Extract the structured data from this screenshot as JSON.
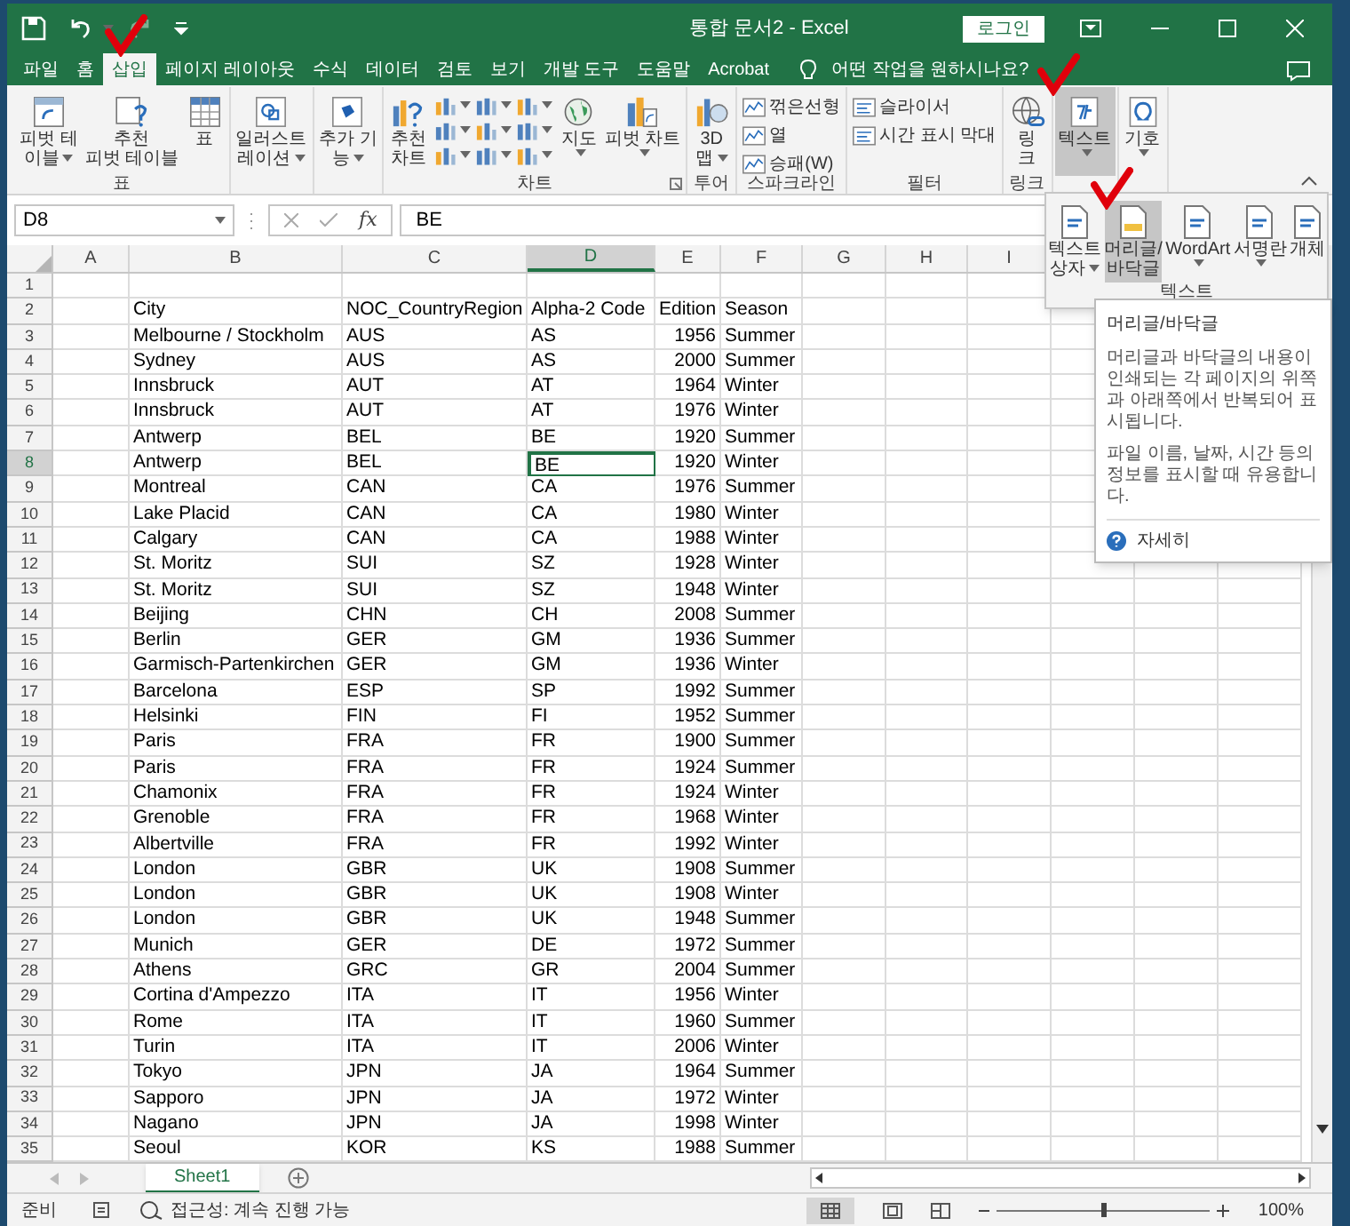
{
  "title_bar": {
    "title": "통합 문서2 - Excel",
    "login": "로그인"
  },
  "tabs": [
    {
      "label": "파일",
      "selected": false
    },
    {
      "label": "홈",
      "selected": false
    },
    {
      "label": "삽입",
      "selected": true
    },
    {
      "label": "페이지 레이아웃",
      "selected": false
    },
    {
      "label": "수식",
      "selected": false
    },
    {
      "label": "데이터",
      "selected": false
    },
    {
      "label": "검토",
      "selected": false
    },
    {
      "label": "보기",
      "selected": false
    },
    {
      "label": "개발 도구",
      "selected": false
    },
    {
      "label": "도움말",
      "selected": false
    },
    {
      "label": "Acrobat",
      "selected": false
    }
  ],
  "tell_me": "어떤 작업을 원하시나요?",
  "ribbon": {
    "groups": [
      {
        "label": "표",
        "launcher": false,
        "items": [
          {
            "kind": "large",
            "lines": [
              "피벗 테",
              "이블"
            ],
            "dropdown": true,
            "expanded": false
          },
          {
            "kind": "large",
            "lines": [
              "추천",
              "피벗 테이블"
            ],
            "dropdown": false,
            "expanded": false
          },
          {
            "kind": "large",
            "lines": [
              "표"
            ],
            "dropdown": false,
            "expanded": false
          }
        ]
      },
      {
        "launcher": false,
        "items": [
          {
            "kind": "large",
            "lines": [
              "일러스트",
              "레이션"
            ],
            "dropdown": true,
            "expanded": false
          }
        ]
      },
      {
        "launcher": false,
        "items": [
          {
            "kind": "large",
            "lines": [
              "추가 기",
              "능"
            ],
            "dropdown": true,
            "expanded": false
          }
        ]
      },
      {
        "label": "차트",
        "launcher": true,
        "items": [
          {
            "kind": "large",
            "lines": [
              "추천",
              "차트"
            ],
            "dropdown": false,
            "expanded": false
          },
          {
            "kind": "chart_grid"
          },
          {
            "kind": "large",
            "lines": [
              "지도"
            ],
            "dropdown": true,
            "expanded": false
          },
          {
            "kind": "large",
            "lines": [
              "피벗 차트"
            ],
            "dropdown": true,
            "expanded": false
          }
        ]
      },
      {
        "label": "투어",
        "launcher": false,
        "items": [
          {
            "kind": "large",
            "lines": [
              "3D",
              "맵"
            ],
            "dropdown": true,
            "expanded": false
          }
        ]
      },
      {
        "label": "스파크라인",
        "launcher": false,
        "items": [
          {
            "kind": "small",
            "label": "꺾은선형"
          },
          {
            "kind": "small",
            "label": "열"
          },
          {
            "kind": "small",
            "label": "승패(W)"
          }
        ]
      },
      {
        "label": "필터",
        "launcher": false,
        "items": [
          {
            "kind": "small",
            "label": "슬라이서"
          },
          {
            "kind": "small",
            "label": "시간 표시 막대"
          }
        ]
      },
      {
        "label": "링크",
        "launcher": false,
        "items": [
          {
            "kind": "large",
            "lines": [
              "링",
              "크"
            ],
            "dropdown": false,
            "expanded": false
          }
        ]
      },
      {
        "launcher": false,
        "items": [
          {
            "kind": "large",
            "lines": [
              "텍스트"
            ],
            "dropdown": true,
            "expanded": true
          }
        ]
      },
      {
        "launcher": false,
        "items": [
          {
            "kind": "large",
            "lines": [
              "기호"
            ],
            "dropdown": true,
            "expanded": false
          }
        ]
      }
    ]
  },
  "text_panel": {
    "label": "텍스트",
    "items": [
      {
        "lines": [
          "텍스트",
          "상자"
        ],
        "dropdown": true,
        "selected": false
      },
      {
        "lines": [
          "머리글/",
          "바닥글"
        ],
        "dropdown": false,
        "selected": true
      },
      {
        "lines": [
          "WordArt"
        ],
        "dropdown": true,
        "selected": false
      },
      {
        "lines": [
          "서명란"
        ],
        "dropdown": true,
        "selected": false
      },
      {
        "lines": [
          "개체"
        ],
        "dropdown": false,
        "selected": false
      }
    ]
  },
  "tooltip": {
    "title": "머리글/바닥글",
    "paragraphs": [
      "머리글과 바닥글의 내용이 인쇄되는 각 페이지의 위쪽과 아래쪽에서 반복되어 표시됩니다.",
      "파일 이름, 날짜, 시간 등의 정보를 표시할 때 유용합니다."
    ],
    "link": "자세히"
  },
  "formula_bar": {
    "name_box": "D8",
    "function_label": "fx",
    "value": "BE"
  },
  "columns": [
    {
      "label": "A",
      "selected": false,
      "kind": "text"
    },
    {
      "label": "B",
      "selected": false,
      "kind": "text"
    },
    {
      "label": "C",
      "selected": false,
      "kind": "text"
    },
    {
      "label": "D",
      "selected": true,
      "kind": "text"
    },
    {
      "label": "E",
      "selected": false,
      "kind": "number"
    },
    {
      "label": "F",
      "selected": false,
      "kind": "text"
    },
    {
      "label": "G",
      "selected": false,
      "kind": "text"
    },
    {
      "label": "H",
      "selected": false,
      "kind": "text"
    },
    {
      "label": "I",
      "selected": false,
      "kind": "text"
    }
  ],
  "rows": [
    {
      "number": "1",
      "selected": false,
      "cells": {}
    },
    {
      "number": "2",
      "selected": false,
      "cells": {
        "B": "City",
        "C": "NOC_CountryRegion",
        "D": "Alpha-2 Code",
        "E": "Edition",
        "F": "Season"
      }
    },
    {
      "number": "3",
      "selected": false,
      "cells": {
        "B": "Melbourne / Stockholm",
        "C": "AUS",
        "D": "AS",
        "E": "1956",
        "F": "Summer"
      }
    },
    {
      "number": "4",
      "selected": false,
      "cells": {
        "B": "Sydney",
        "C": "AUS",
        "D": "AS",
        "E": "2000",
        "F": "Summer"
      }
    },
    {
      "number": "5",
      "selected": false,
      "cells": {
        "B": "Innsbruck",
        "C": "AUT",
        "D": "AT",
        "E": "1964",
        "F": "Winter"
      }
    },
    {
      "number": "6",
      "selected": false,
      "cells": {
        "B": "Innsbruck",
        "C": "AUT",
        "D": "AT",
        "E": "1976",
        "F": "Winter"
      }
    },
    {
      "number": "7",
      "selected": false,
      "cells": {
        "B": "Antwerp",
        "C": "BEL",
        "D": "BE",
        "E": "1920",
        "F": "Summer"
      }
    },
    {
      "number": "8",
      "selected": true,
      "cells": {
        "B": "Antwerp",
        "C": "BEL",
        "D": "BE",
        "E": "1920",
        "F": "Winter"
      }
    },
    {
      "number": "9",
      "selected": false,
      "cells": {
        "B": "Montreal",
        "C": "CAN",
        "D": "CA",
        "E": "1976",
        "F": "Summer"
      }
    },
    {
      "number": "10",
      "selected": false,
      "cells": {
        "B": "Lake Placid",
        "C": "CAN",
        "D": "CA",
        "E": "1980",
        "F": "Winter"
      }
    },
    {
      "number": "11",
      "selected": false,
      "cells": {
        "B": "Calgary",
        "C": "CAN",
        "D": "CA",
        "E": "1988",
        "F": "Winter"
      }
    },
    {
      "number": "12",
      "selected": false,
      "cells": {
        "B": "St. Moritz",
        "C": "SUI",
        "D": "SZ",
        "E": "1928",
        "F": "Winter"
      }
    },
    {
      "number": "13",
      "selected": false,
      "cells": {
        "B": "St. Moritz",
        "C": "SUI",
        "D": "SZ",
        "E": "1948",
        "F": "Winter"
      }
    },
    {
      "number": "14",
      "selected": false,
      "cells": {
        "B": "Beijing",
        "C": "CHN",
        "D": "CH",
        "E": "2008",
        "F": "Summer"
      }
    },
    {
      "number": "15",
      "selected": false,
      "cells": {
        "B": "Berlin",
        "C": "GER",
        "D": "GM",
        "E": "1936",
        "F": "Summer"
      }
    },
    {
      "number": "16",
      "selected": false,
      "cells": {
        "B": "Garmisch-Partenkirchen",
        "C": "GER",
        "D": "GM",
        "E": "1936",
        "F": "Winter"
      }
    },
    {
      "number": "17",
      "selected": false,
      "cells": {
        "B": "Barcelona",
        "C": "ESP",
        "D": "SP",
        "E": "1992",
        "F": "Summer"
      }
    },
    {
      "number": "18",
      "selected": false,
      "cells": {
        "B": "Helsinki",
        "C": "FIN",
        "D": "FI",
        "E": "1952",
        "F": "Summer"
      }
    },
    {
      "number": "19",
      "selected": false,
      "cells": {
        "B": "Paris",
        "C": "FRA",
        "D": "FR",
        "E": "1900",
        "F": "Summer"
      }
    },
    {
      "number": "20",
      "selected": false,
      "cells": {
        "B": "Paris",
        "C": "FRA",
        "D": "FR",
        "E": "1924",
        "F": "Summer"
      }
    },
    {
      "number": "21",
      "selected": false,
      "cells": {
        "B": "Chamonix",
        "C": "FRA",
        "D": "FR",
        "E": "1924",
        "F": "Winter"
      }
    },
    {
      "number": "22",
      "selected": false,
      "cells": {
        "B": "Grenoble",
        "C": "FRA",
        "D": "FR",
        "E": "1968",
        "F": "Winter"
      }
    },
    {
      "number": "23",
      "selected": false,
      "cells": {
        "B": "Albertville",
        "C": "FRA",
        "D": "FR",
        "E": "1992",
        "F": "Winter"
      }
    },
    {
      "number": "24",
      "selected": false,
      "cells": {
        "B": "London",
        "C": "GBR",
        "D": "UK",
        "E": "1908",
        "F": "Summer"
      }
    },
    {
      "number": "25",
      "selected": false,
      "cells": {
        "B": "London",
        "C": "GBR",
        "D": "UK",
        "E": "1908",
        "F": "Winter"
      }
    },
    {
      "number": "26",
      "selected": false,
      "cells": {
        "B": "London",
        "C": "GBR",
        "D": "UK",
        "E": "1948",
        "F": "Summer"
      }
    },
    {
      "number": "27",
      "selected": false,
      "cells": {
        "B": "Munich",
        "C": "GER",
        "D": "DE",
        "E": "1972",
        "F": "Summer"
      }
    },
    {
      "number": "28",
      "selected": false,
      "cells": {
        "B": "Athens",
        "C": "GRC",
        "D": "GR",
        "E": "2004",
        "F": "Summer"
      }
    },
    {
      "number": "29",
      "selected": false,
      "cells": {
        "B": "Cortina d'Ampezzo",
        "C": "ITA",
        "D": "IT",
        "E": "1956",
        "F": "Winter"
      }
    },
    {
      "number": "30",
      "selected": false,
      "cells": {
        "B": "Rome",
        "C": "ITA",
        "D": "IT",
        "E": "1960",
        "F": "Summer"
      }
    },
    {
      "number": "31",
      "selected": false,
      "cells": {
        "B": "Turin",
        "C": "ITA",
        "D": "IT",
        "E": "2006",
        "F": "Winter"
      }
    },
    {
      "number": "32",
      "selected": false,
      "cells": {
        "B": "Tokyo",
        "C": "JPN",
        "D": "JA",
        "E": "1964",
        "F": "Summer"
      }
    },
    {
      "number": "33",
      "selected": false,
      "cells": {
        "B": "Sapporo",
        "C": "JPN",
        "D": "JA",
        "E": "1972",
        "F": "Winter"
      }
    },
    {
      "number": "34",
      "selected": false,
      "cells": {
        "B": "Nagano",
        "C": "JPN",
        "D": "JA",
        "E": "1998",
        "F": "Winter"
      }
    },
    {
      "number": "35",
      "selected": false,
      "cells": {
        "B": "Seoul",
        "C": "KOR",
        "D": "KS",
        "E": "1988",
        "F": "Summer"
      }
    }
  ],
  "sheets": [
    {
      "label": "Sheet1",
      "selected": true
    }
  ],
  "status_bar": {
    "ready": "준비",
    "accessibility": "접근성: 계속 진행 가능",
    "zoom_slider": {
      "level": 0.5
    },
    "zoom": "100%"
  }
}
